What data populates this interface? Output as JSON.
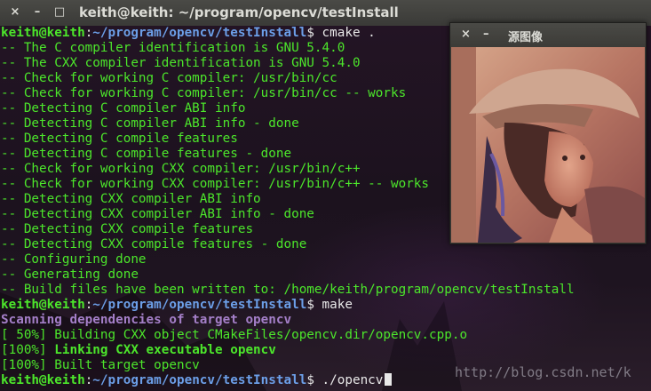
{
  "window": {
    "close_glyph": "×",
    "minimize_glyph": "–",
    "maximize_glyph": "□",
    "title": "keith@keith: ~/program/opencv/testInstall"
  },
  "terminal": {
    "lines": [
      {
        "segs": [
          {
            "t": "keith@keith",
            "c": "gb"
          },
          {
            "t": ":",
            "c": "w"
          },
          {
            "t": "~/program/opencv/testInstall",
            "c": "b"
          },
          {
            "t": "$ cmake .",
            "c": "w"
          }
        ]
      },
      {
        "segs": [
          {
            "t": "-- The C compiler identification is GNU 5.4.0",
            "c": "g"
          }
        ]
      },
      {
        "segs": [
          {
            "t": "-- The CXX compiler identification is GNU 5.4.0",
            "c": "g"
          }
        ]
      },
      {
        "segs": [
          {
            "t": "-- Check for working C compiler: /usr/bin/cc",
            "c": "g"
          }
        ]
      },
      {
        "segs": [
          {
            "t": "-- Check for working C compiler: /usr/bin/cc -- works",
            "c": "g"
          }
        ]
      },
      {
        "segs": [
          {
            "t": "-- Detecting C compiler ABI info",
            "c": "g"
          }
        ]
      },
      {
        "segs": [
          {
            "t": "-- Detecting C compiler ABI info - done",
            "c": "g"
          }
        ]
      },
      {
        "segs": [
          {
            "t": "-- Detecting C compile features",
            "c": "g"
          }
        ]
      },
      {
        "segs": [
          {
            "t": "-- Detecting C compile features - done",
            "c": "g"
          }
        ]
      },
      {
        "segs": [
          {
            "t": "-- Check for working CXX compiler: /usr/bin/c++",
            "c": "g"
          }
        ]
      },
      {
        "segs": [
          {
            "t": "-- Check for working CXX compiler: /usr/bin/c++ -- works",
            "c": "g"
          }
        ]
      },
      {
        "segs": [
          {
            "t": "-- Detecting CXX compiler ABI info",
            "c": "g"
          }
        ]
      },
      {
        "segs": [
          {
            "t": "-- Detecting CXX compiler ABI info - done",
            "c": "g"
          }
        ]
      },
      {
        "segs": [
          {
            "t": "-- Detecting CXX compile features",
            "c": "g"
          }
        ]
      },
      {
        "segs": [
          {
            "t": "-- Detecting CXX compile features - done",
            "c": "g"
          }
        ]
      },
      {
        "segs": [
          {
            "t": "-- Configuring done",
            "c": "g"
          }
        ]
      },
      {
        "segs": [
          {
            "t": "-- Generating done",
            "c": "g"
          }
        ]
      },
      {
        "segs": [
          {
            "t": "-- Build files have been written to: /home/keith/program/opencv/testInstall",
            "c": "g"
          }
        ]
      },
      {
        "segs": [
          {
            "t": "keith@keith",
            "c": "gb"
          },
          {
            "t": ":",
            "c": "w"
          },
          {
            "t": "~/program/opencv/testInstall",
            "c": "b"
          },
          {
            "t": "$ make",
            "c": "w"
          }
        ]
      },
      {
        "segs": [
          {
            "t": "Scanning dependencies of target opencv",
            "c": "pu"
          }
        ]
      },
      {
        "segs": [
          {
            "t": "[ 50%] Building CXX object CMakeFiles/opencv.dir/opencv.cpp.o",
            "c": "g"
          }
        ]
      },
      {
        "segs": [
          {
            "t": "[100%] ",
            "c": "g"
          },
          {
            "t": "Linking CXX executable opencv",
            "c": "gb"
          }
        ]
      },
      {
        "segs": [
          {
            "t": "[100%] Built target opencv",
            "c": "g"
          }
        ]
      },
      {
        "segs": [
          {
            "t": "keith@keith",
            "c": "gb"
          },
          {
            "t": ":",
            "c": "w"
          },
          {
            "t": "~/program/opencv/testInstall",
            "c": "b"
          },
          {
            "t": "$ ./opencv",
            "c": "w"
          }
        ]
      }
    ]
  },
  "image_window": {
    "close_glyph": "×",
    "minimize_glyph": "–",
    "title": "源图像"
  },
  "watermark": "http://blog.csdn.net/k"
}
